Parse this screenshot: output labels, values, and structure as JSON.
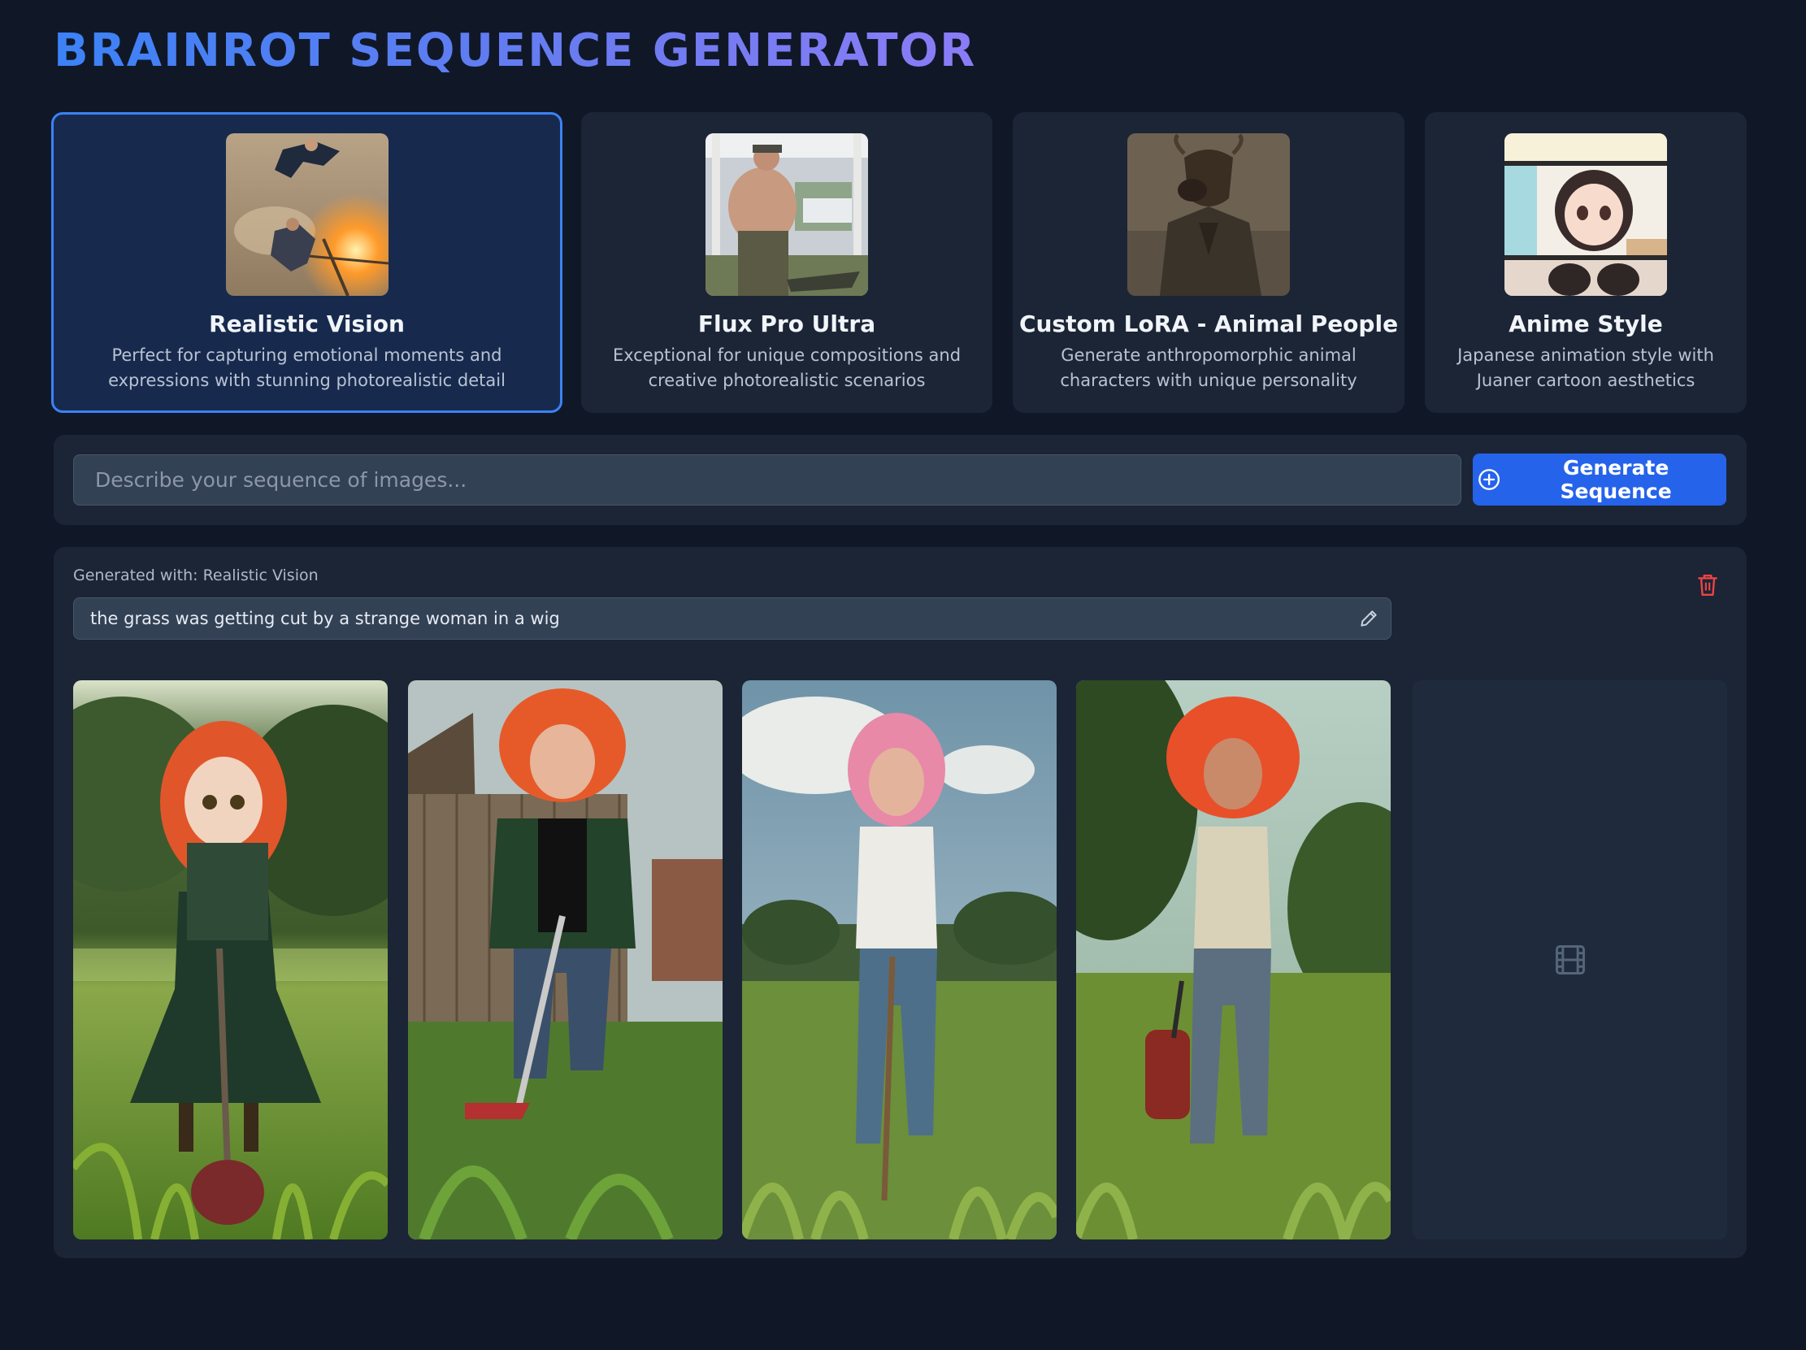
{
  "app": {
    "title": "BRAINROT SEQUENCE GENERATOR"
  },
  "models": [
    {
      "name": "Realistic Vision",
      "description": "Perfect for capturing emotional moments and expressions with stunning photorealistic detail",
      "selected": true,
      "thumbnail": "action-scene-thumbnail"
    },
    {
      "name": "Flux Pro Ultra",
      "description": "Exceptional for unique compositions and creative photorealistic scenarios",
      "selected": false,
      "thumbnail": "man-with-alligator-thumbnail"
    },
    {
      "name": "Custom LoRA - Animal People",
      "description": "Generate anthropomorphic animal characters with unique personality",
      "selected": false,
      "thumbnail": "bull-in-suit-thumbnail"
    },
    {
      "name": "Anime Style",
      "description": "Japanese animation style with Juaner cartoon aesthetics",
      "selected": false,
      "thumbnail": "anime-comic-thumbnail"
    }
  ],
  "prompt": {
    "placeholder": "Describe your sequence of images...",
    "value": "",
    "button_label": "Generate Sequence",
    "button_icon": "plus-circle-icon"
  },
  "result": {
    "generated_with_label": "Generated with: Realistic Vision",
    "prompt_text": "the grass was getting cut by a strange woman in a wig",
    "frames": [
      {
        "content": "doll-woman-with-orange-wig-mowing-grass"
      },
      {
        "content": "woman-with-orange-wig-trimming-grass-by-fence"
      },
      {
        "content": "woman-with-pink-wig-in-field"
      },
      {
        "content": "woman-with-red-wig-in-tall-grass"
      }
    ],
    "placeholder_icon": "film-icon",
    "delete_icon": "trash-icon",
    "edit_icon": "pencil-icon"
  },
  "colors": {
    "background": "#101828",
    "panel": "#1c2535",
    "accent": "#2563eb",
    "selected_border": "#3b82f6",
    "delete": "#ef4444"
  }
}
